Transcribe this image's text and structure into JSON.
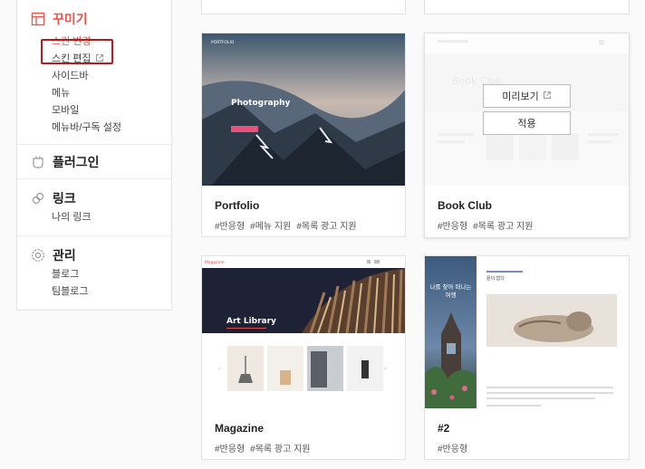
{
  "sidebar": {
    "customize": {
      "title": "꾸미기",
      "items": [
        {
          "label": "스킨 변경"
        },
        {
          "label": "스킨 편집"
        },
        {
          "label": "사이드바"
        },
        {
          "label": "메뉴"
        },
        {
          "label": "모바일"
        },
        {
          "label": "메뉴바/구독 설정"
        }
      ]
    },
    "plugin": {
      "title": "플러그인"
    },
    "link": {
      "title": "링크",
      "items": [
        {
          "label": "나의 링크"
        }
      ]
    },
    "manage": {
      "title": "관리",
      "items": [
        {
          "label": "블로그"
        },
        {
          "label": "팀블로그"
        }
      ]
    }
  },
  "skins": [
    {
      "name": "Portfolio",
      "tags": [
        "#반응형",
        "#메뉴 지원",
        "#목록 광고 지원"
      ],
      "preview_text": {
        "brand": "PORTFOLIO",
        "headline": "Photography"
      }
    },
    {
      "name": "Book Club",
      "tags": [
        "#반응형",
        "#목록 광고 지원"
      ],
      "preview_text": {
        "headline": "Book Club"
      },
      "buttons": {
        "preview": "미리보기",
        "apply": "적용"
      }
    },
    {
      "name": "Magazine",
      "tags": [
        "#반응형",
        "#목록 광고 지원"
      ],
      "preview_text": {
        "brand": "Magazine",
        "headline": "Art Library"
      }
    },
    {
      "name": "#2",
      "tags": [
        "#반응형"
      ],
      "preview_text": {
        "side_text": "나를 찾아 떠나는 여행",
        "small": "끝이 없다"
      }
    }
  ],
  "colors": {
    "accent": "#ef5048",
    "highlight_box": "#b71c1c"
  }
}
